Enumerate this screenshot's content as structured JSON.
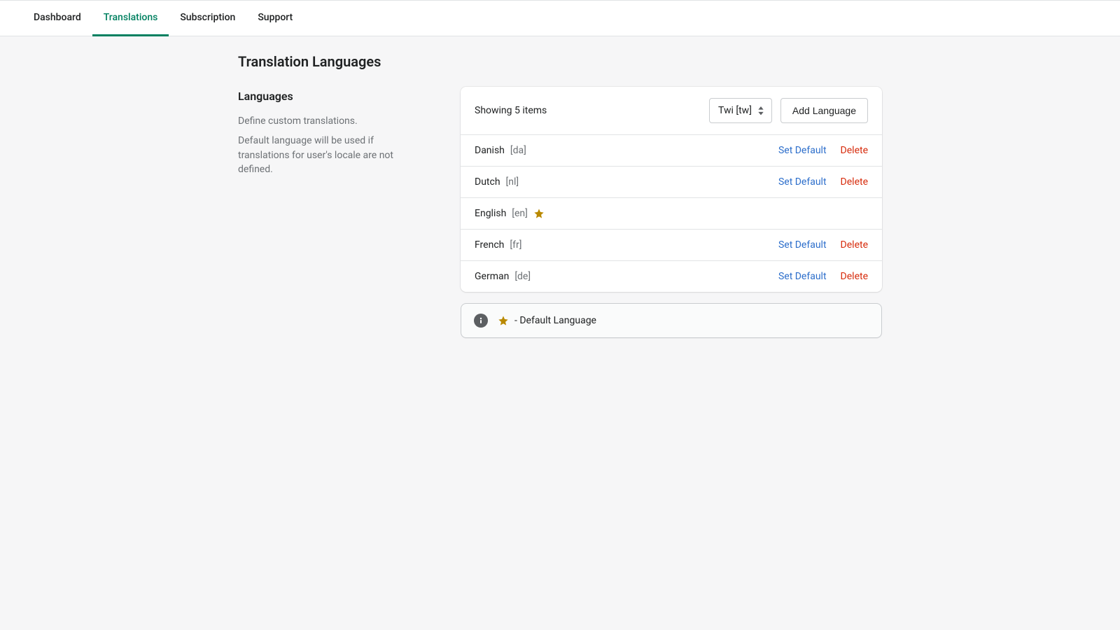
{
  "nav": {
    "tabs": [
      {
        "label": "Dashboard",
        "active": false
      },
      {
        "label": "Translations",
        "active": true
      },
      {
        "label": "Subscription",
        "active": false
      },
      {
        "label": "Support",
        "active": false
      }
    ]
  },
  "page": {
    "title": "Translation Languages"
  },
  "sidebar": {
    "heading": "Languages",
    "desc1": "Define custom translations.",
    "desc2": "Default language will be used if translations for user's locale are not defined."
  },
  "list": {
    "showing": "Showing 5 items",
    "selector_value": "Twi [tw]",
    "add_button": "Add Language",
    "set_default_label": "Set Default",
    "delete_label": "Delete",
    "rows": [
      {
        "name": "Danish",
        "code": "[da]",
        "is_default": false
      },
      {
        "name": "Dutch",
        "code": "[nl]",
        "is_default": false
      },
      {
        "name": "English",
        "code": "[en]",
        "is_default": true
      },
      {
        "name": "French",
        "code": "[fr]",
        "is_default": false
      },
      {
        "name": "German",
        "code": "[de]",
        "is_default": false
      }
    ]
  },
  "legend": {
    "text": "- Default Language"
  },
  "colors": {
    "accent": "#008060",
    "link": "#2c6ecb",
    "danger": "#d72c0d",
    "star": "#b98900"
  }
}
